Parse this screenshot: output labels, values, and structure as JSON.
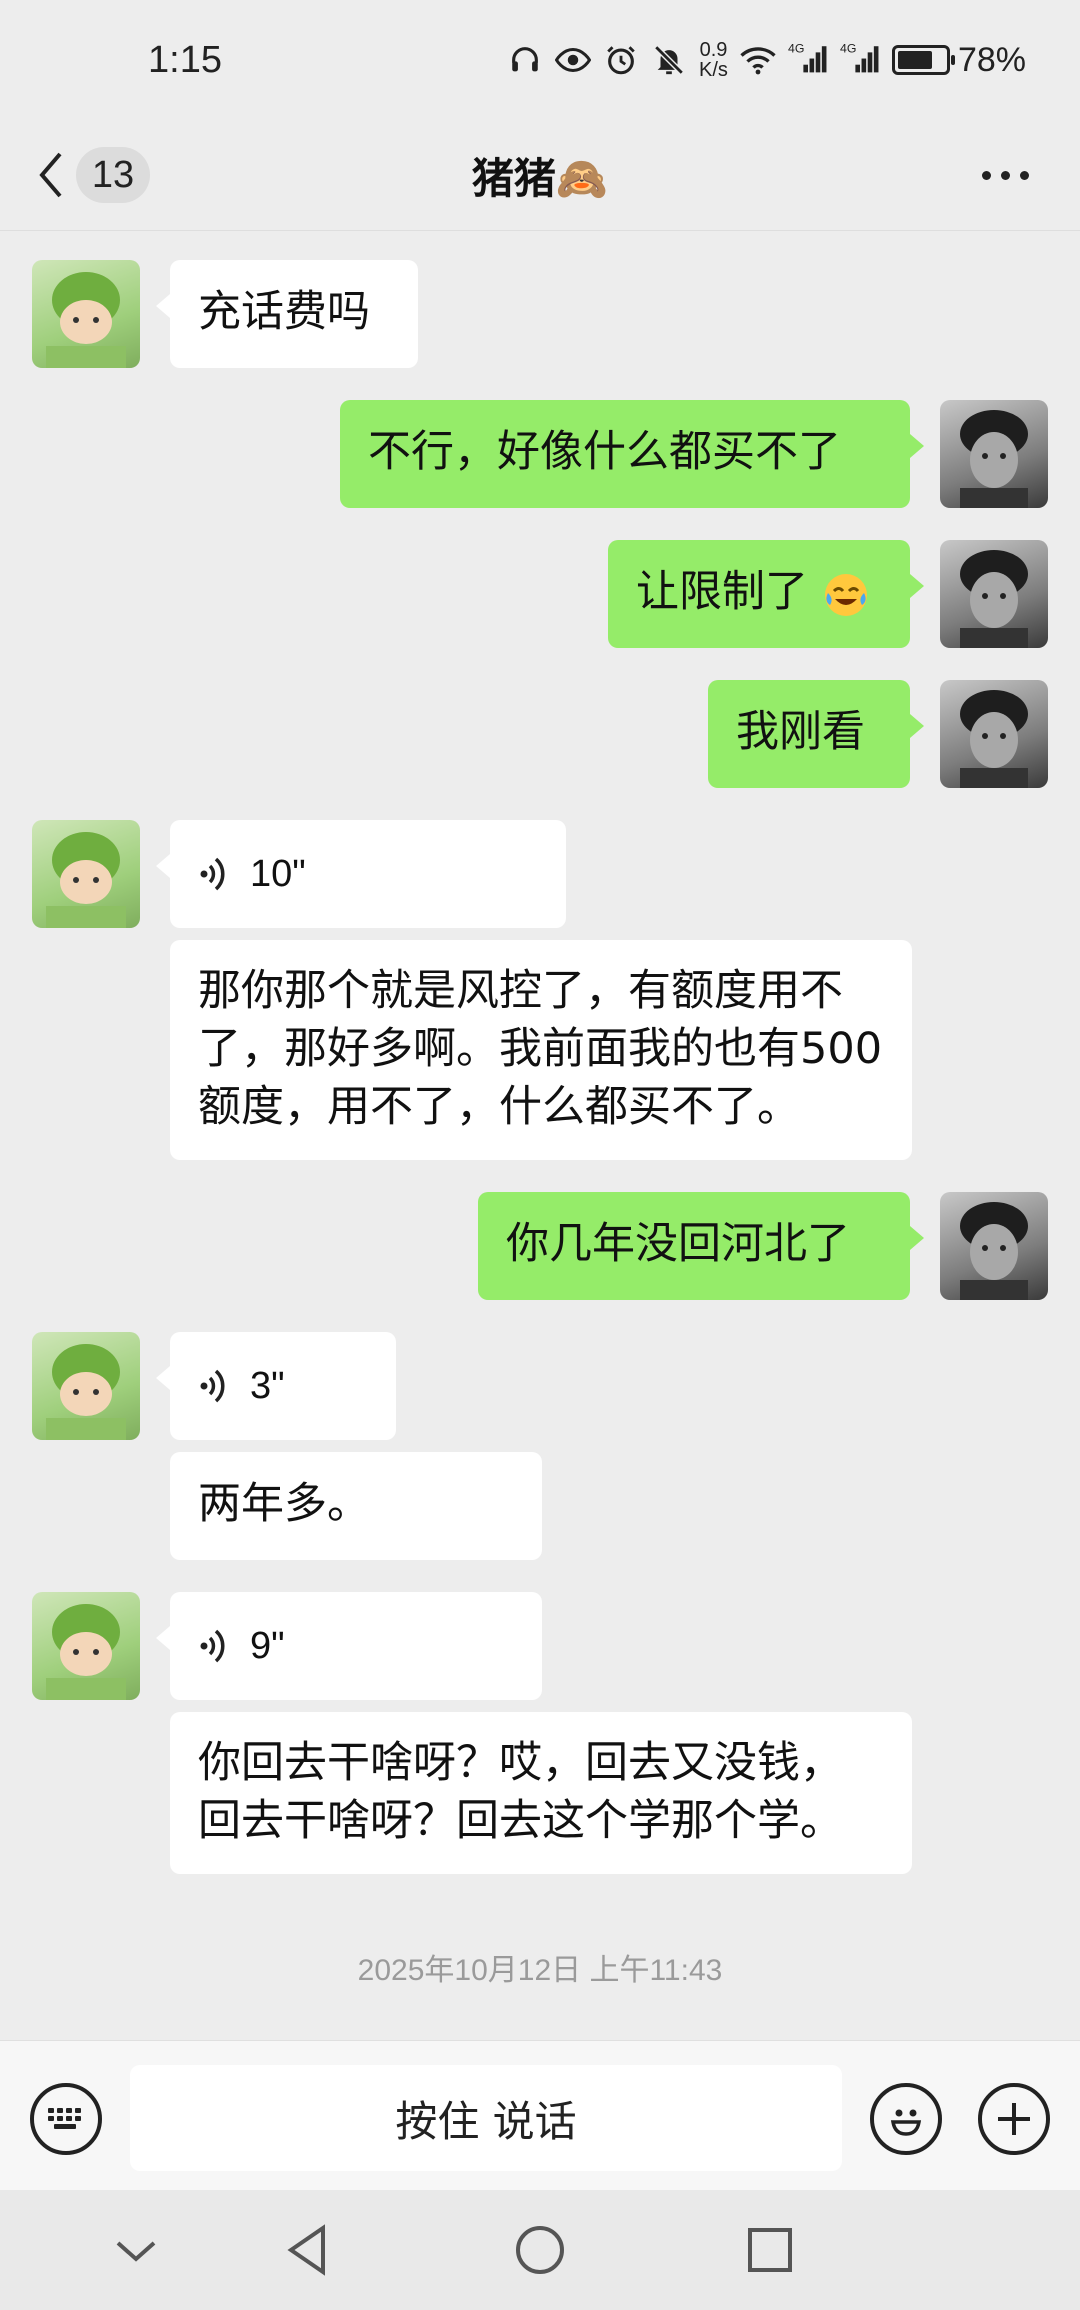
{
  "status_bar": {
    "time": "1:15",
    "net_speed_value": "0.9",
    "net_speed_unit": "K/s",
    "signal1_label": "4G",
    "signal2_label": "4G",
    "battery_percent": "78%",
    "battery_level": 0.78
  },
  "header": {
    "unread_count": "13",
    "title": "猪猪🙈"
  },
  "messages": [
    {
      "from": "friend",
      "type": "text",
      "text": "充话费吗"
    },
    {
      "from": "me",
      "type": "text",
      "text": "不行，好像什么都买不了"
    },
    {
      "from": "me",
      "type": "text",
      "text": "让限制了",
      "emoji": "crying-laughing-face"
    },
    {
      "from": "me",
      "type": "text",
      "text": "我刚看"
    },
    {
      "from": "friend",
      "type": "voice",
      "duration": "10\""
    },
    {
      "from": "friend",
      "type": "transcript",
      "text": "那你那个就是风控了，有额度用不了，那好多啊。我前面我的也有500额度，用不了，什么都买不了。"
    },
    {
      "from": "me",
      "type": "text",
      "text": "你几年没回河北了"
    },
    {
      "from": "friend",
      "type": "voice",
      "duration": "3\""
    },
    {
      "from": "friend",
      "type": "transcript",
      "text": "两年多。"
    },
    {
      "from": "friend",
      "type": "voice",
      "duration": "9\""
    },
    {
      "from": "friend",
      "type": "transcript",
      "text": "你回去干啥呀？哎，回去又没钱，回去干啥呀？回去这个学那个学。"
    }
  ],
  "timestamp": "2025年10月12日 上午11:43",
  "input_bar": {
    "hold_to_talk": "按住 说话"
  },
  "colors": {
    "outgoing_bubble": "#95ec69",
    "incoming_bubble": "#ffffff",
    "background": "#ededed"
  }
}
